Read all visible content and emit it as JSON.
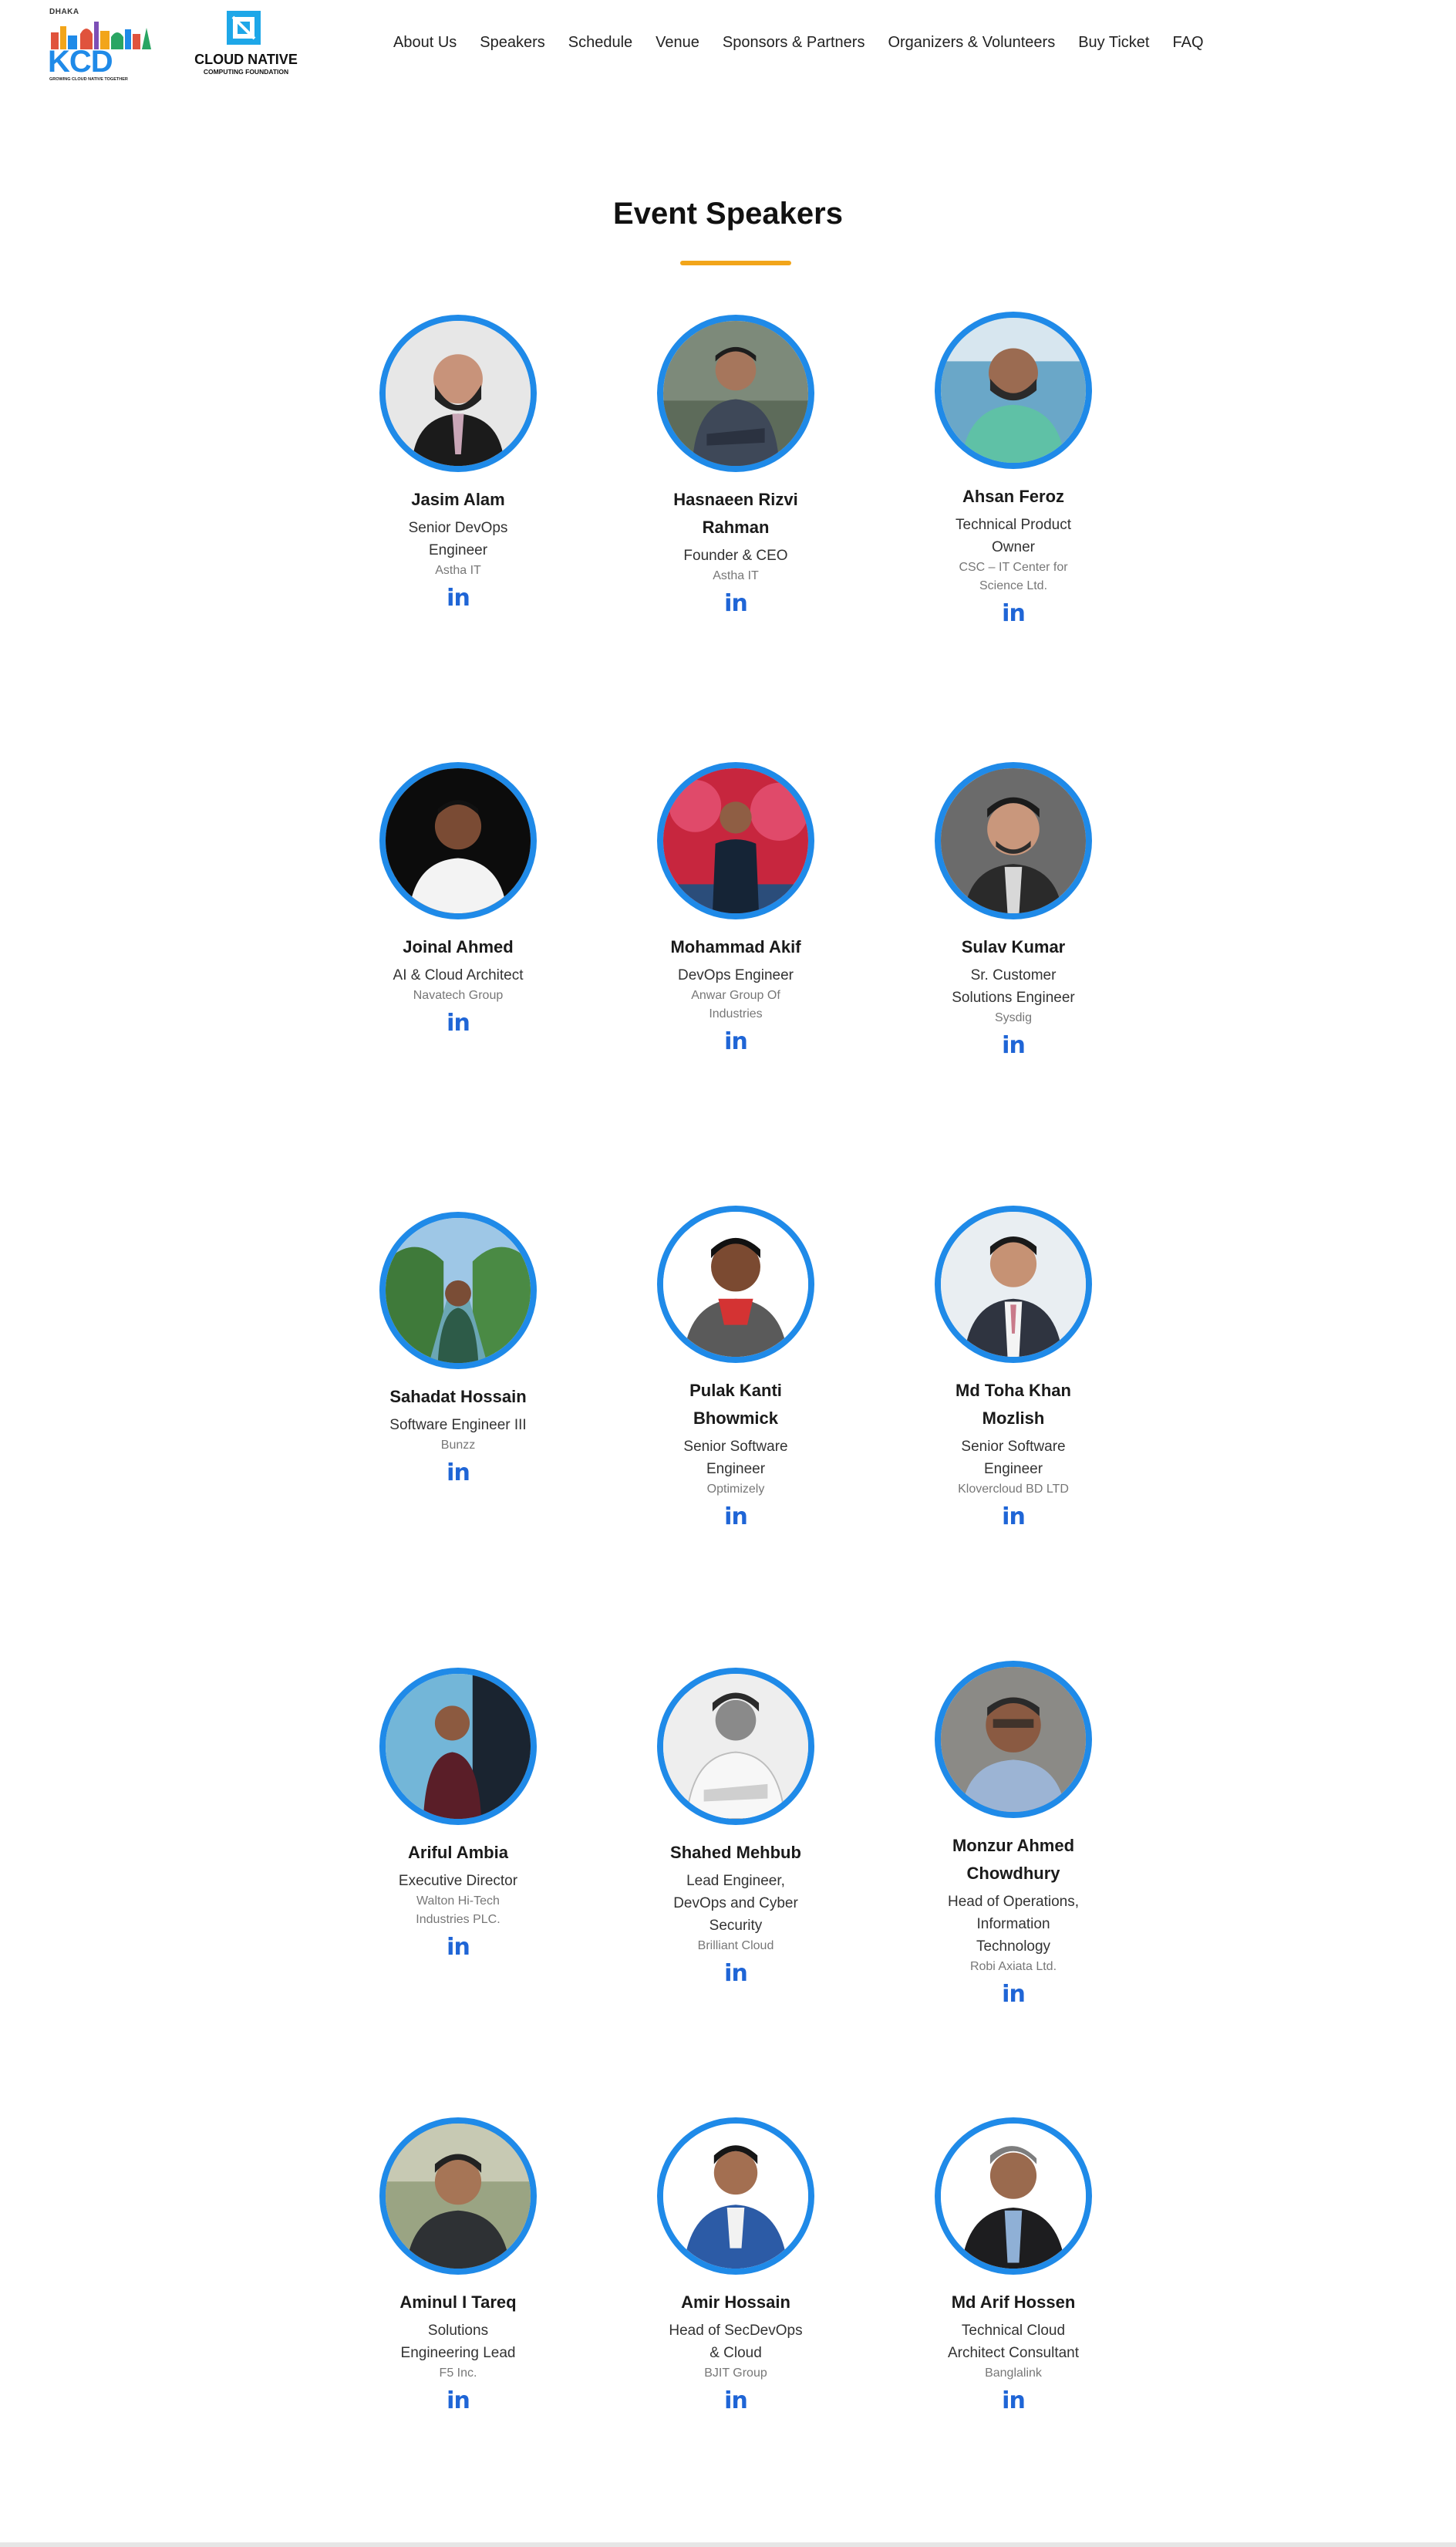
{
  "header": {
    "kcd_logo": {
      "city": "DHAKA",
      "mark": "KCD",
      "tagline": "GROWING CLOUD NATIVE TOGETHER"
    },
    "cncf_logo": {
      "name": "CLOUD NATIVE",
      "subtitle": "COMPUTING FOUNDATION"
    },
    "nav": [
      "About Us",
      "Speakers",
      "Schedule",
      "Venue",
      "Sponsors & Partners",
      "Organizers & Volunteers",
      "Buy Ticket",
      "FAQ"
    ]
  },
  "section": {
    "title": "Event Speakers"
  },
  "linkedin_glyph": "in",
  "colors": {
    "accent_blue": "#1f8ae8",
    "underline_orange": "#f2a51a",
    "linkedin_blue": "#1f65d6"
  },
  "speakers": [
    {
      "name": "Jasim Alam",
      "role": "Senior DevOps Engineer",
      "company": "Astha IT"
    },
    {
      "name": "Hasnaeen Rizvi Rahman",
      "role": "Founder & CEO",
      "company": "Astha IT"
    },
    {
      "name": "Ahsan Feroz",
      "role": "Technical Product Owner",
      "company": "CSC – IT Center for Science Ltd."
    },
    {
      "name": "Joinal Ahmed",
      "role": "AI & Cloud Architect",
      "company": "Navatech Group"
    },
    {
      "name": "Mohammad Akif",
      "role": "DevOps Engineer",
      "company": "Anwar Group Of Industries"
    },
    {
      "name": "Sulav Kumar",
      "role": "Sr. Customer Solutions Engineer",
      "company": "Sysdig"
    },
    {
      "name": "Sahadat Hossain",
      "role": "Software Engineer III",
      "company": "Bunzz"
    },
    {
      "name": "Pulak Kanti Bhowmick",
      "role": "Senior Software Engineer",
      "company": "Optimizely"
    },
    {
      "name": "Md Toha Khan Mozlish",
      "role": "Senior Software Engineer",
      "company": "Klovercloud BD LTD"
    },
    {
      "name": "Ariful Ambia",
      "role": "Executive Director",
      "company": "Walton Hi-Tech Industries PLC."
    },
    {
      "name": "Shahed Mehbub",
      "role": "Lead Engineer, DevOps and Cyber Security",
      "company": "Brilliant Cloud"
    },
    {
      "name": "Monzur Ahmed Chowdhury",
      "role": "Head of Operations, Information Technology",
      "company": "Robi Axiata Ltd."
    },
    {
      "name": "Aminul I Tareq",
      "role": "Solutions Engineering Lead",
      "company": "F5 Inc."
    },
    {
      "name": "Amir Hossain",
      "role": "Head of SecDevOps & Cloud",
      "company": "BJIT Group"
    },
    {
      "name": "Md Arif Hossen",
      "role": "Technical Cloud Architect Consultant",
      "company": "Banglalink"
    }
  ]
}
